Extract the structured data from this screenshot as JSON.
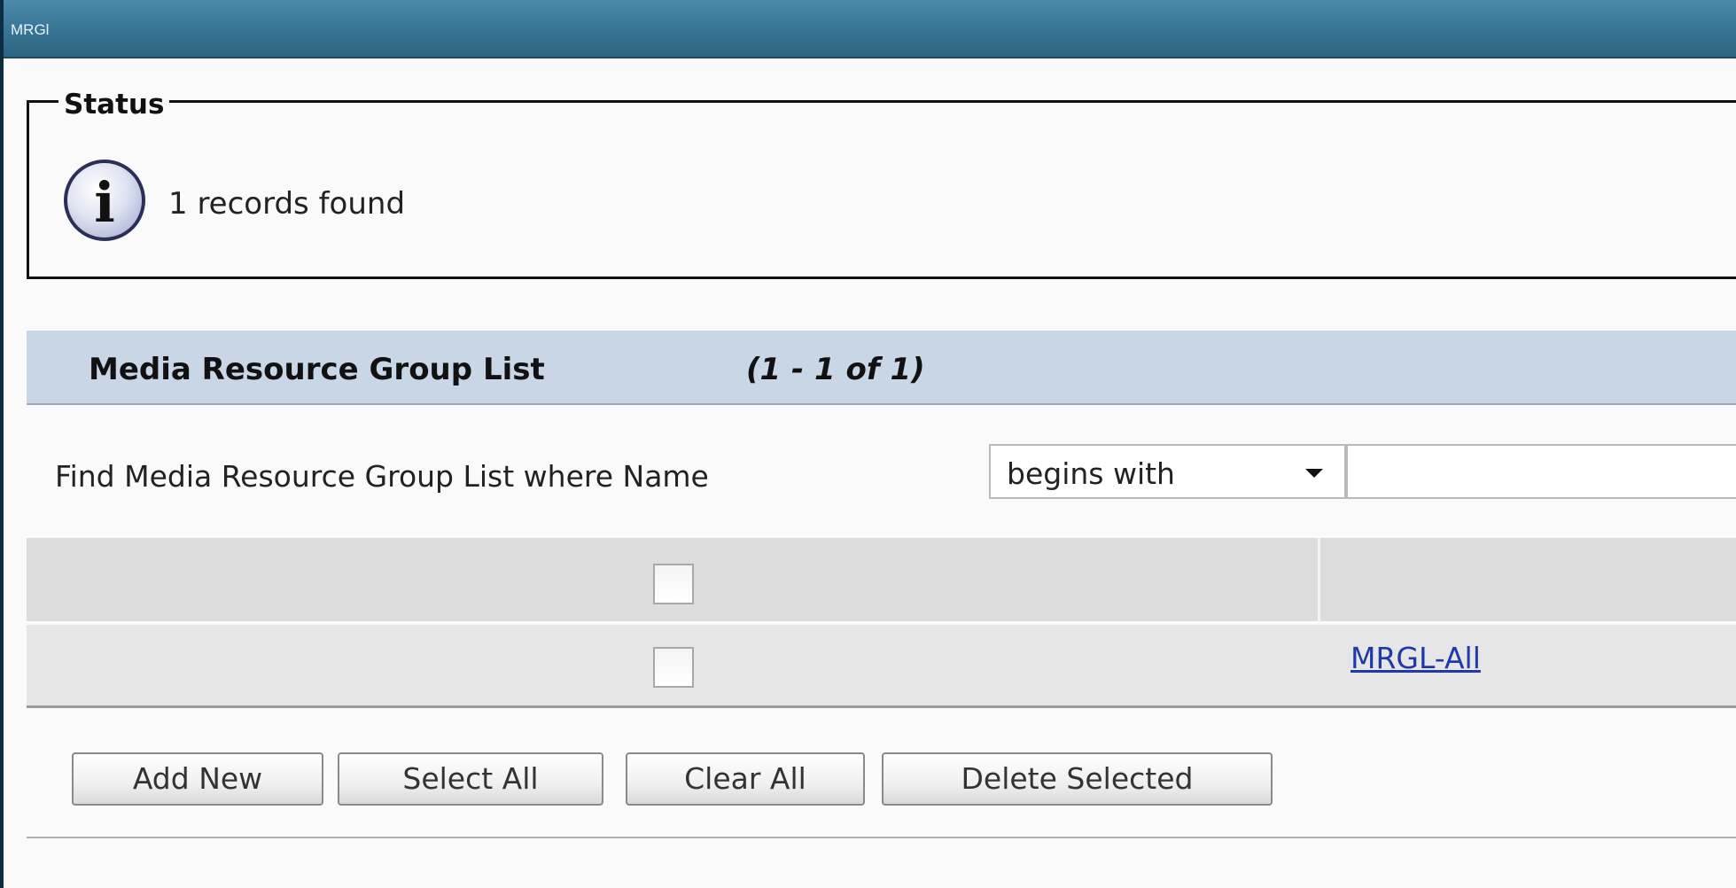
{
  "window": {
    "title": "MRGl"
  },
  "status": {
    "legend": "Status",
    "icon": "info-icon",
    "icon_glyph": "i",
    "message": "1 records found"
  },
  "list": {
    "title": "Media Resource Group List",
    "range": "(1 - 1 of 1)"
  },
  "find": {
    "label": "Find Media Resource Group List where Name",
    "operator": "begins with",
    "value": ""
  },
  "table": {
    "rows": [
      {
        "name": "MRGL-All",
        "checked": false
      }
    ]
  },
  "buttons": {
    "add_new": "Add New",
    "select_all": "Select All",
    "clear_all": "Clear All",
    "delete_selected": "Delete Selected"
  },
  "colors": {
    "titlebar": "#3b7897",
    "header_band": "#c9d6e6",
    "link": "#1e3aa8"
  }
}
